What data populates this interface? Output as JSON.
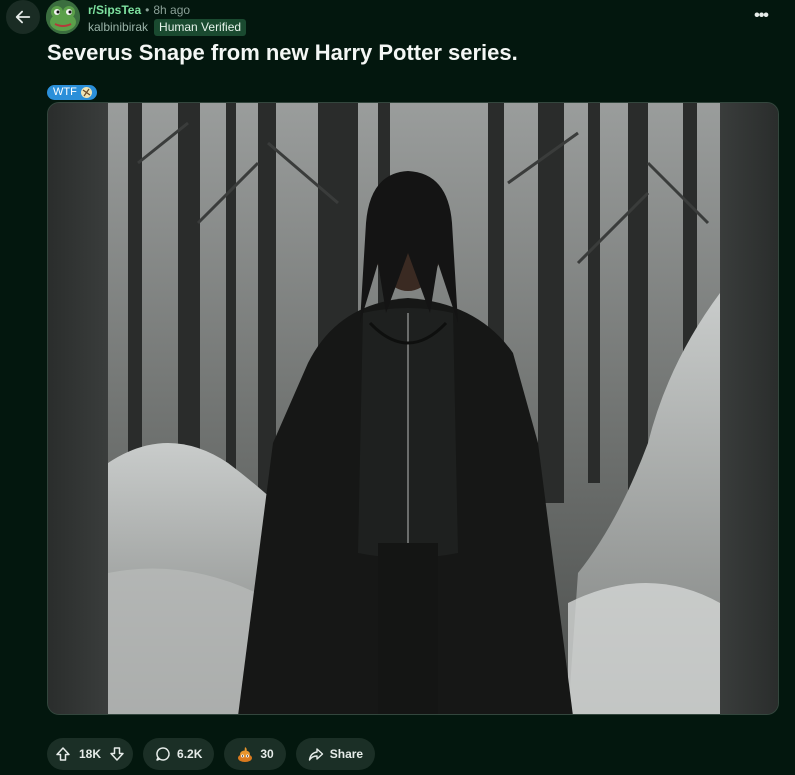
{
  "header": {
    "subreddit": "r/SipsTea",
    "separator": "•",
    "time_ago": "8h ago",
    "username": "kalbinibirak",
    "user_flair": "Human Verified",
    "more_label": "•••"
  },
  "post": {
    "title": "Severus Snape from new Harry Potter series.",
    "flair": "WTF",
    "flair_color": "#2b8fd9"
  },
  "actions": {
    "upvotes": "18K",
    "comments": "6.2K",
    "awards": "30",
    "share_label": "Share"
  },
  "colors": {
    "background": "#03170e",
    "accent": "#7ee2a0"
  }
}
